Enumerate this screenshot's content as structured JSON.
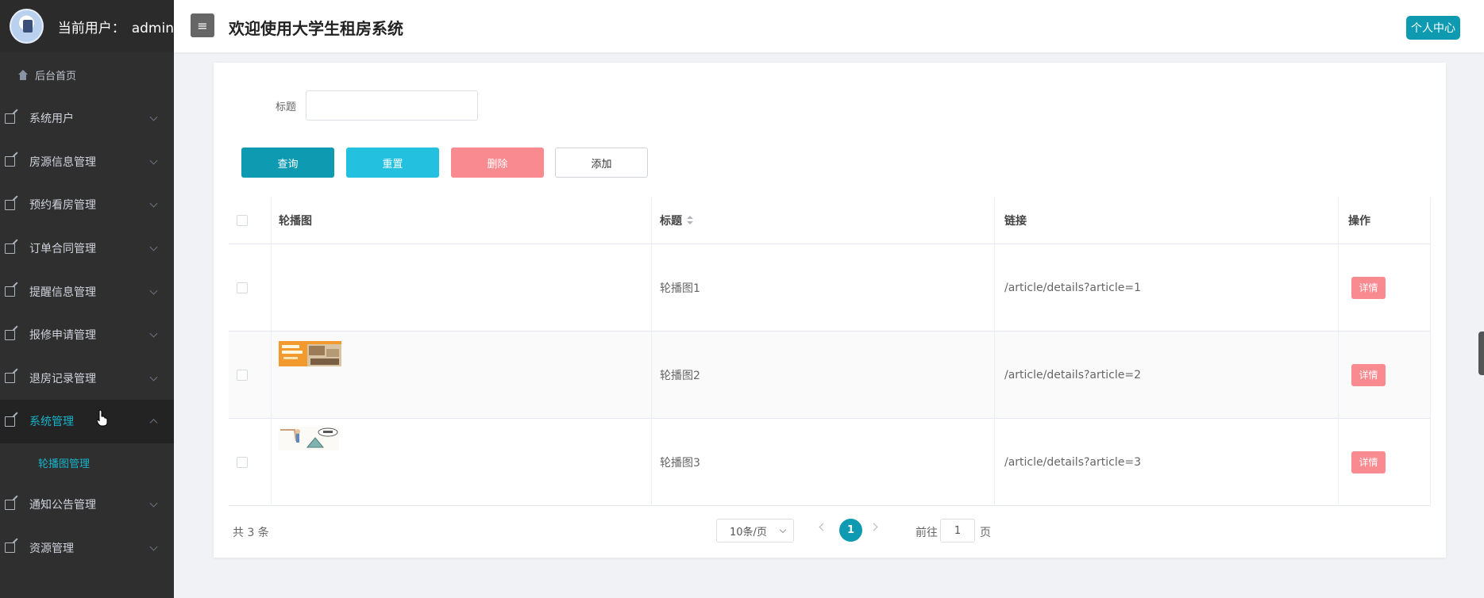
{
  "sidebar": {
    "user_label": "当前用户：",
    "username": "admin",
    "home": "后台首页",
    "menu": [
      {
        "label": "系统用户"
      },
      {
        "label": "房源信息管理"
      },
      {
        "label": "预约看房管理"
      },
      {
        "label": "订单合同管理"
      },
      {
        "label": "提醒信息管理"
      },
      {
        "label": "报修申请管理"
      },
      {
        "label": "退房记录管理"
      },
      {
        "label": "系统管理",
        "active": true
      }
    ],
    "submenu": {
      "label": "轮播图管理"
    },
    "menu_after": [
      {
        "label": "通知公告管理"
      },
      {
        "label": "资源管理"
      }
    ]
  },
  "header": {
    "menu_toggle_icon": "≡",
    "title": "欢迎使用大学生租房系统",
    "profile_button": "个人中心"
  },
  "filter": {
    "title_label": "标题",
    "title_value": ""
  },
  "buttons": {
    "search": "查询",
    "reset": "重置",
    "delete": "删除",
    "add": "添加"
  },
  "table": {
    "columns": [
      "轮播图",
      "标题",
      "链接",
      "操作"
    ],
    "rows": [
      {
        "title": "轮播图1",
        "link": "/article/details?article=1",
        "action": "详情"
      },
      {
        "title": "轮播图2",
        "link": "/article/details?article=2",
        "action": "详情"
      },
      {
        "title": "轮播图3",
        "link": "/article/details?article=3",
        "action": "详情"
      }
    ]
  },
  "pagination": {
    "total": "共 3 条",
    "page_size": "10条/页",
    "current_page": "1",
    "goto_label": "前往",
    "goto_value": "1",
    "page_suffix": "页"
  },
  "colors": {
    "accent": "#0e9ab0",
    "danger": "#f88a90",
    "info": "#23c0e0",
    "sidebar_bg": "#2f2f2f"
  }
}
